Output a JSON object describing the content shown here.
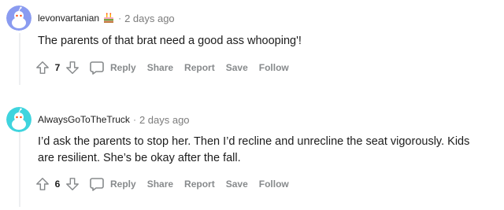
{
  "comments": [
    {
      "author": "levonvartanian",
      "separator": "·",
      "time": "2 days ago",
      "avatar_color": "#8a9bf0",
      "flair_icon": "cake-icon",
      "body": "The parents of that brat need a good ass whooping'!",
      "score": "7",
      "actions": {
        "reply": "Reply",
        "share": "Share",
        "report": "Report",
        "save": "Save",
        "follow": "Follow"
      }
    },
    {
      "author": "AlwaysGoToTheTruck",
      "separator": "·",
      "time": "2 days ago",
      "avatar_color": "#3fd4de",
      "body": "I’d ask the parents to stop her. Then I’d recline and unrecline the seat vigorously. Kids are resilient. She’s be okay after the fall.",
      "score": "6",
      "actions": {
        "reply": "Reply",
        "share": "Share",
        "report": "Report",
        "save": "Save",
        "follow": "Follow"
      }
    }
  ]
}
